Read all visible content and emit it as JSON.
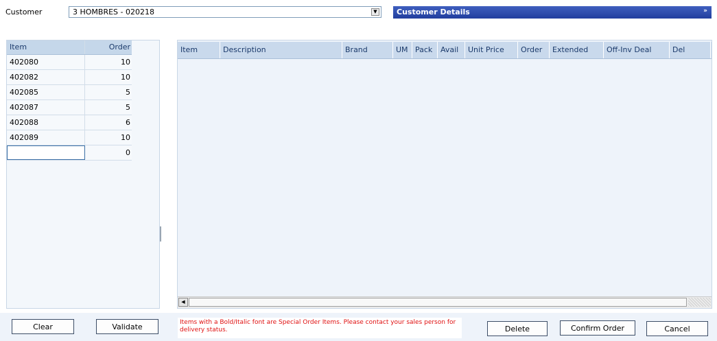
{
  "customer": {
    "label": "Customer",
    "selected": "3 HOMBRES - 020218"
  },
  "details_bar": {
    "title": "Customer Details",
    "chevron": "»"
  },
  "order_grid": {
    "headers": {
      "item": "Item",
      "order": "Order"
    },
    "rows": [
      {
        "item": "402080",
        "order": "10"
      },
      {
        "item": "402082",
        "order": "10"
      },
      {
        "item": "402085",
        "order": "5"
      },
      {
        "item": "402087",
        "order": "5"
      },
      {
        "item": "402088",
        "order": "6"
      },
      {
        "item": "402089",
        "order": "10"
      },
      {
        "item": "",
        "order": "0"
      }
    ]
  },
  "items_grid": {
    "headers": [
      "Item",
      "Description",
      "Brand",
      "UM",
      "Pack",
      "Avail",
      "Unit Price",
      "Order",
      "Extended",
      "Off-Inv Deal",
      "Del"
    ],
    "rows": []
  },
  "footer": {
    "clear": "Clear",
    "validate": "Validate",
    "note": "Items with a Bold/Italic font are Special Order Items. Please contact your sales person for delivery status.",
    "delete": "Delete",
    "confirm": "Confirm Order",
    "cancel": "Cancel"
  },
  "colors": {
    "details_bar": "#2c48a8",
    "note_text": "#e01010",
    "grid_header": "#c9d9ec"
  }
}
